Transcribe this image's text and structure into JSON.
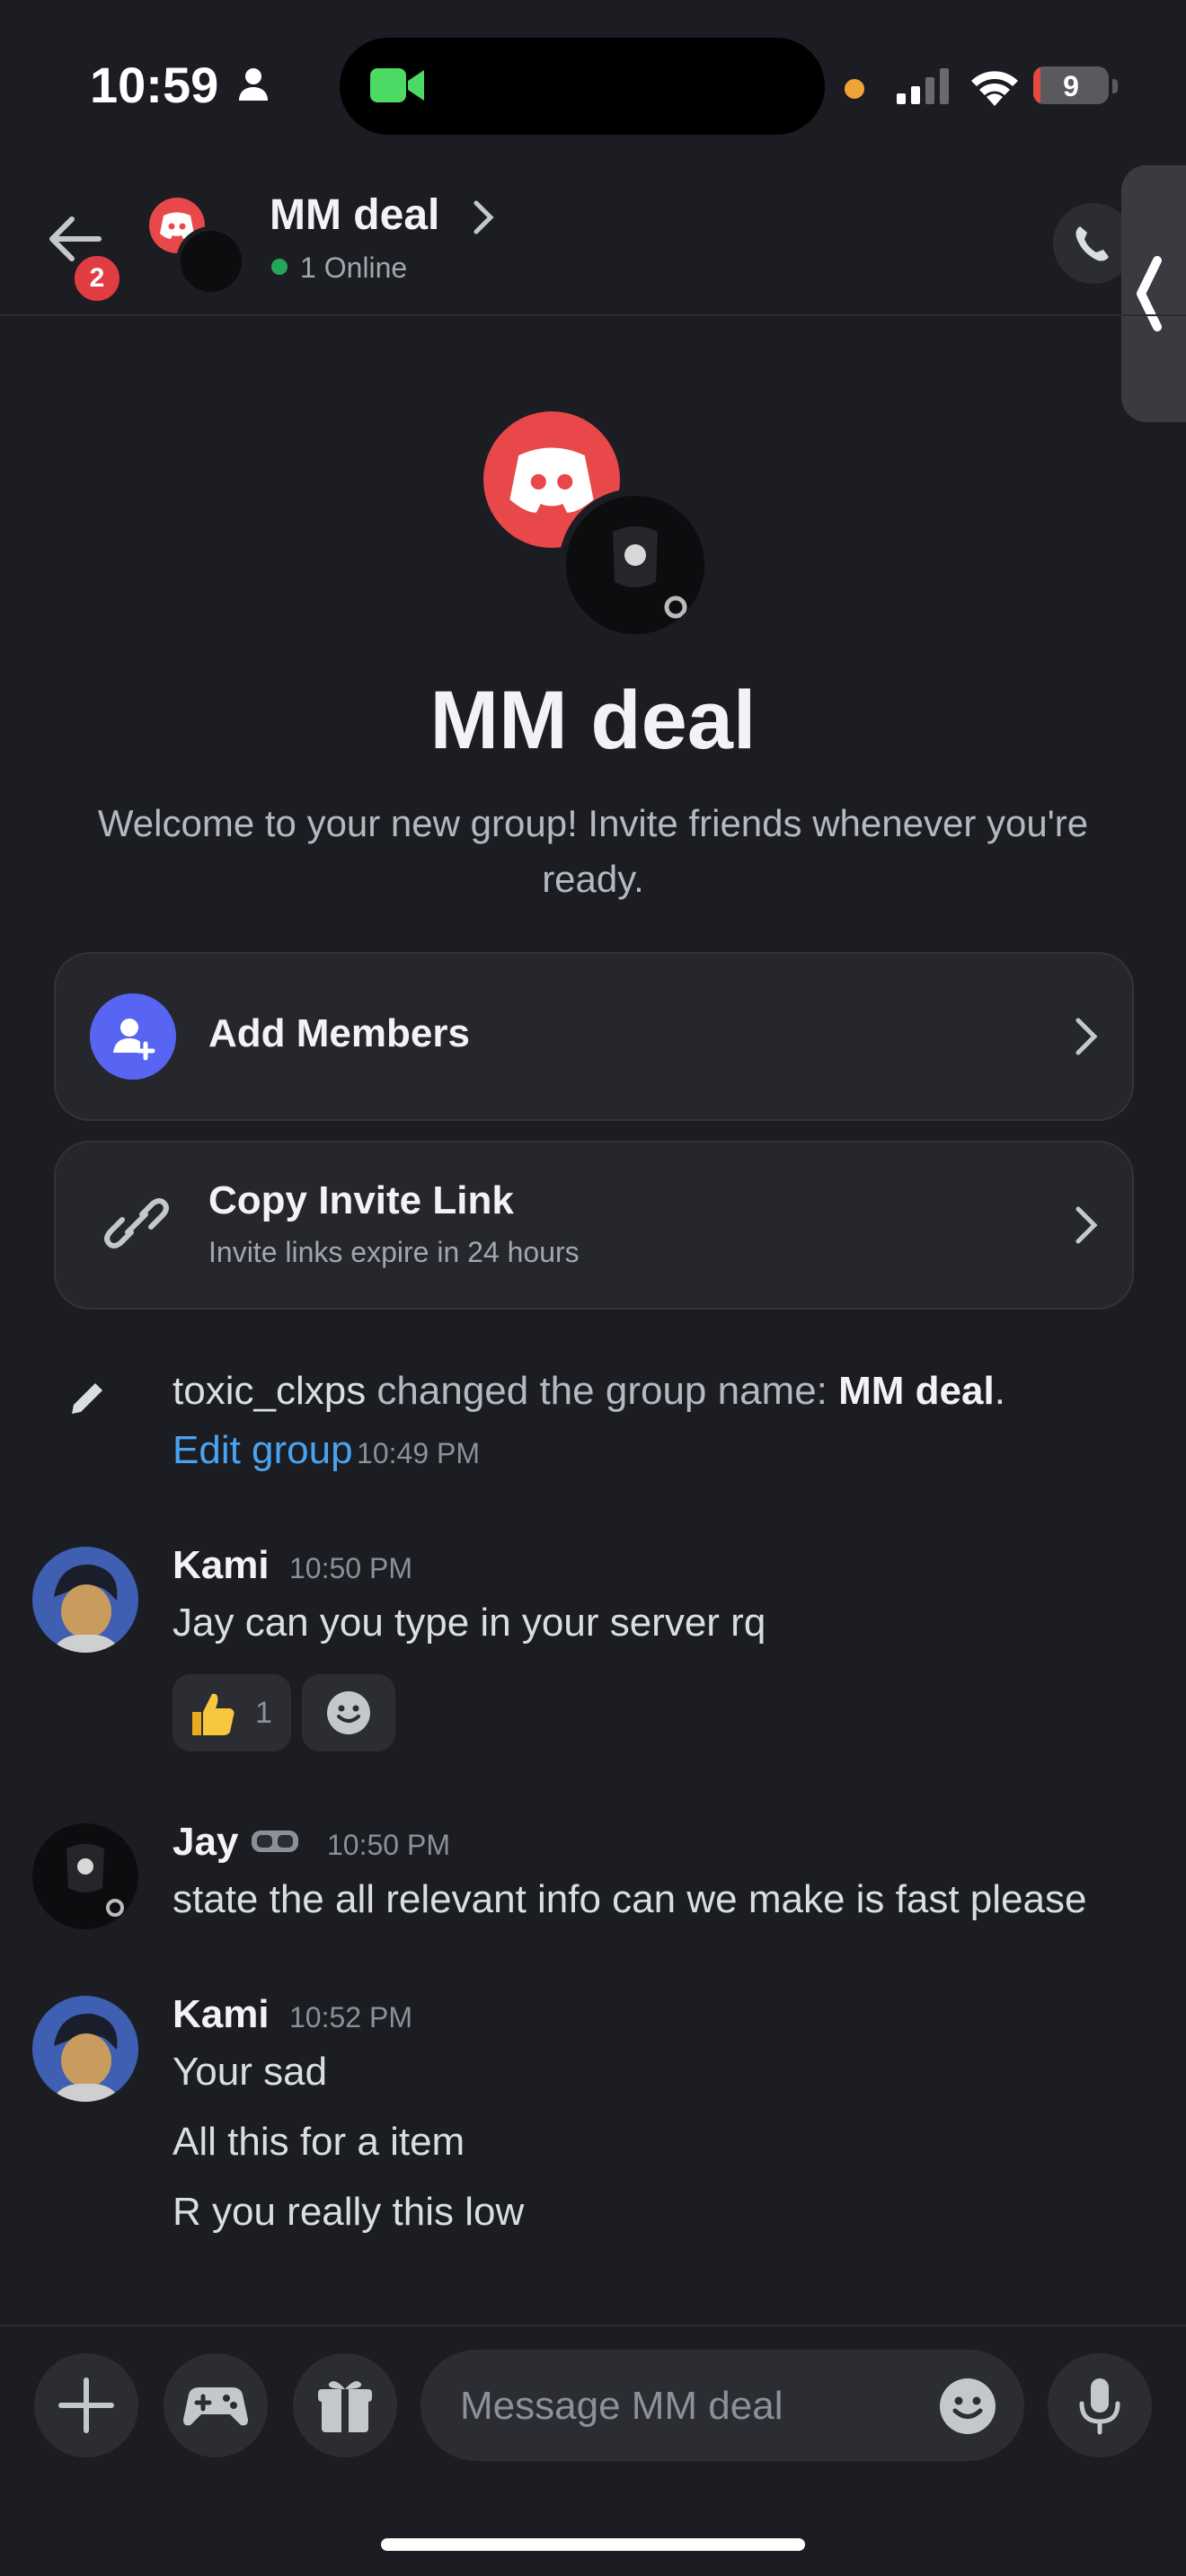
{
  "status_bar": {
    "time": "10:59",
    "battery": "9",
    "battery_level": 0.09
  },
  "header": {
    "title": "MM deal",
    "back_badge": "2",
    "online": "1 Online"
  },
  "hero": {
    "title": "MM deal",
    "welcome": "Welcome to your new group! Invite friends whenever you're ready."
  },
  "actions": {
    "add_members": "Add Members",
    "copy_invite": "Copy Invite Link",
    "copy_invite_sub": "Invite links expire in 24 hours"
  },
  "system_message": {
    "user": "toxic_clxps",
    "text": " changed the group name: ",
    "name": "MM deal",
    "period": ".",
    "link": "Edit group",
    "time": "10:49 PM"
  },
  "messages": [
    {
      "author": "Kami",
      "time": "10:50 PM",
      "lines": [
        "Jay can you type in your server rq"
      ],
      "reaction_count": "1"
    },
    {
      "author": "Jay",
      "time": "10:50 PM",
      "lines": [
        "state the all relevant info can we make is fast please"
      ]
    },
    {
      "author": "Kami",
      "time": "10:52 PM",
      "lines": [
        "Your sad",
        "All this for a item",
        "R you really this low"
      ]
    }
  ],
  "composer": {
    "placeholder": "Message MM deal"
  },
  "icons": {
    "back": "arrow-left-icon",
    "call": "phone-icon",
    "add_member": "person-plus-icon",
    "link": "link-icon",
    "edit": "pencil-icon",
    "plus": "plus-icon",
    "game": "gamepad-icon",
    "gift": "gift-icon",
    "emoji": "smile-icon",
    "mic": "microphone-icon"
  },
  "colors": {
    "accent": "#5865f2",
    "link": "#4aa3f0",
    "online": "#23a55a",
    "danger": "#e23c43",
    "background": "#1c1d22"
  }
}
